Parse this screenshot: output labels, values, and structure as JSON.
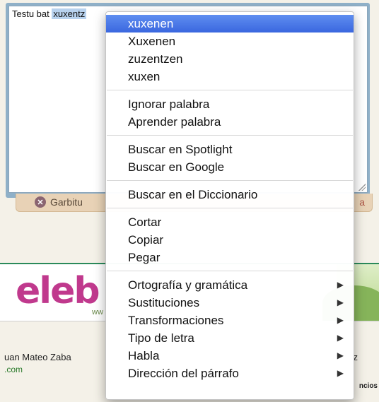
{
  "editor": {
    "text_before": "Testu bat",
    "selected_word": "xuxentz"
  },
  "action_bar": {
    "clear_label": "Garbitu",
    "right_label": "a"
  },
  "banner": {
    "logo": "eleb",
    "subtext": "ww"
  },
  "footer": {
    "left_text": "uan Mateo Zaba",
    "link": ".com",
    "right_text": "z",
    "right_small": "ncios"
  },
  "context_menu": {
    "suggestions": [
      "xuxenen",
      "Xuxenen",
      "zuzentzen",
      "xuxen"
    ],
    "spelling_actions": [
      "Ignorar palabra",
      "Aprender palabra"
    ],
    "search_actions": [
      "Buscar en Spotlight",
      "Buscar en Google"
    ],
    "dictionary_action": "Buscar en el Diccionario",
    "edit_actions": [
      "Cortar",
      "Copiar",
      "Pegar"
    ],
    "submenus": [
      "Ortografía y gramática",
      "Sustituciones",
      "Transformaciones",
      "Tipo de letra",
      "Habla",
      "Dirección del párrafo"
    ],
    "submenu_arrow": "▶"
  }
}
